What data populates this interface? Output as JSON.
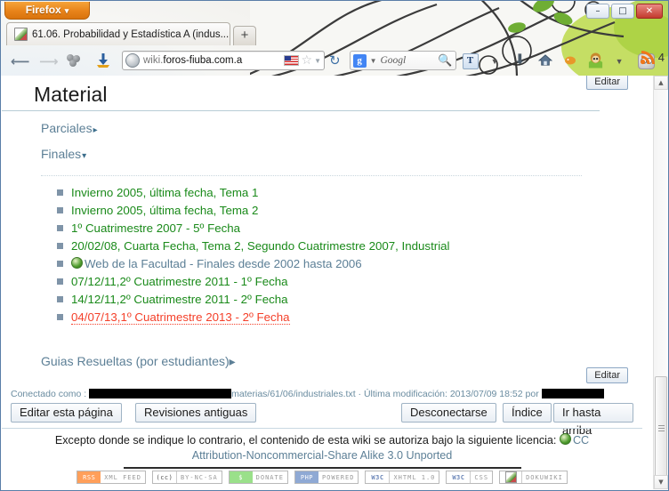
{
  "browser": {
    "app_button": "Firefox",
    "app_button_caret": "▾",
    "tab_title": "61.06. Probabilidad y Estadística A (indus...",
    "new_tab_label": "+",
    "window_minimize": "–",
    "window_restore": "□",
    "window_close": "✕",
    "url": "wiki.foros-fiuba.com.a",
    "url_prefix": "wiki.",
    "url_rest": "foros-fiuba.com.a",
    "search_placeholder": "Googl",
    "search_engine": "g",
    "rss_count": "4",
    "text_tool": "T"
  },
  "page": {
    "title": "Material",
    "edit_top": "Editar",
    "edit_bottom": "Editar",
    "toc": [
      {
        "label": "Parciales",
        "marker": "▸",
        "expanded": false
      },
      {
        "label": "Finales",
        "marker": "▾",
        "expanded": true
      }
    ],
    "finales": [
      {
        "text": "Invierno 2005, última fecha, Tema 1",
        "kind": "wiki"
      },
      {
        "text": "Invierno 2005, última fecha, Tema 2",
        "kind": "wiki"
      },
      {
        "text": "1º Cuatrimestre 2007 - 5º Fecha",
        "kind": "wiki"
      },
      {
        "text": "20/02/08, Cuarta Fecha, Tema 2, Segundo Cuatrimestre 2007, Industrial",
        "kind": "wiki"
      },
      {
        "text": "Web de la Facultad - Finales desde 2002 hasta 2006",
        "kind": "external"
      },
      {
        "text": "07/12/11,2º Cuatrimestre 2011 - 1º Fecha",
        "kind": "wiki"
      },
      {
        "text": "14/12/11,2º Cuatrimestre 2011 - 2º Fecha",
        "kind": "wiki"
      },
      {
        "text": "04/07/13,1º Cuatrimestre 2013 - 2º Fecha",
        "kind": "broken"
      }
    ],
    "guias": {
      "label": "Guias Resueltas (por estudiantes)",
      "marker": "▸"
    }
  },
  "docinfo": {
    "connected_as": "Conectado como :",
    "path": "materias/61/06/industriales.txt",
    "separator": "·",
    "last_modified_label": "Última modificación:",
    "last_modified_value": "2013/07/09 18:52",
    "by": "por"
  },
  "buttons": {
    "edit_page": "Editar esta página",
    "old_revisions": "Revisiones antiguas",
    "logout": "Desconectarse",
    "index": "Índice",
    "top": "Ir hasta arriba"
  },
  "license": {
    "line1": "Excepto donde se indique lo contrario, el contenido de esta wiki se autoriza bajo la siguiente licencia:",
    "link_short": "CC",
    "link_long": "Attribution-Noncommercial-Share Alike 3.0 Unported"
  },
  "badges": [
    {
      "left": "RSS",
      "right": "XML FEED",
      "style": "rss"
    },
    {
      "left": "(cc)",
      "right": "BY-NC-SA",
      "style": "cc"
    },
    {
      "left": "$",
      "right": "DONATE",
      "style": "donate"
    },
    {
      "left": "PHP",
      "right": "POWERED",
      "style": "php"
    },
    {
      "left": "W3C",
      "right": "XHTML 1.0",
      "style": "w3c"
    },
    {
      "left": "W3C",
      "right": "CSS",
      "style": "w3c"
    },
    {
      "left": "",
      "right": "DOKUWIKI",
      "style": "dw"
    }
  ],
  "colors": {
    "wiki_link": "#1a8a1a",
    "broken_link": "#f4402a",
    "external_link": "#5c7f96",
    "heading_rule": "#b8cdd6",
    "bullet": "#7f94a8",
    "firefox_orange": "#e8831a"
  },
  "scrollbar": {
    "up": "▲",
    "down": "▼"
  }
}
